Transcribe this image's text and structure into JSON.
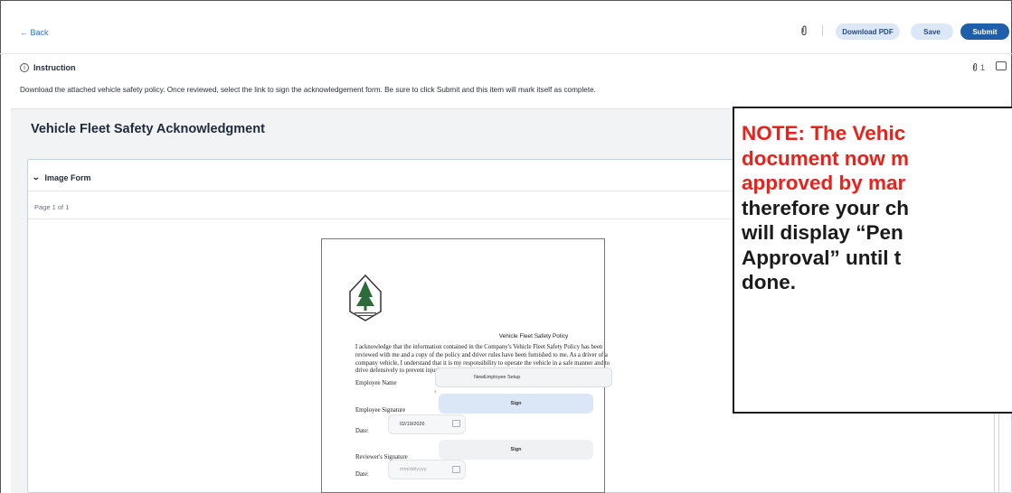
{
  "header": {
    "back_label": "← Back",
    "download_label": "Download PDF",
    "save_label": "Save",
    "submit_label": "Submit"
  },
  "instruction": {
    "heading": "Instruction",
    "text": "Download the attached vehicle safety policy. Once reviewed, select the link to sign the acknowledgement form.  Be sure to click Submit and this item will mark itself as complete.",
    "attachment_count": "1"
  },
  "form": {
    "title": "Vehicle Fleet Safety Acknowledgment",
    "section_label": "Image Form",
    "page_label": "Page 1 of 1"
  },
  "document": {
    "title": "Vehicle Fleet Safety Policy",
    "body": "I acknowledge that the information contained in the Company's Vehicle Fleet Safety Policy has been reviewed with me and a copy of the policy and driver rules have been furnished to me. As a driver of a company vehicle, I understand that it is my responsibility to operate the vehicle in a safe manner and to drive defensively to prevent injuries and property damage.",
    "employee_name_label": "Employee Name",
    "employee_name_value": "NewEmployee Setup",
    "employee_signature_label": "Employee Signature",
    "sign_label": "Sign",
    "date_label": "Date:",
    "date_value": "02/19/2026",
    "reviewer_signature_label": "Reviewer's Signature",
    "reviewer_sign_label": "Sign",
    "reviewer_date_label": "Date:",
    "reviewer_date_placeholder": "mm/dd/yyyy"
  },
  "note": {
    "red_lines": [
      "NOTE: The Vehic",
      "document now m",
      "approved by mar"
    ],
    "black_lines": [
      "therefore your ch",
      "will display “Pen",
      "Approval” until t",
      "done."
    ]
  },
  "colors": {
    "accent": "#1f5ea8",
    "note_red": "#e8211b",
    "panel_border": "#bcd2e8"
  },
  "icons": {
    "attachment": "paperclip-icon",
    "info": "info-icon",
    "comment": "comment-icon",
    "calendar": "calendar-icon",
    "chevron": "chevron-down-icon"
  }
}
